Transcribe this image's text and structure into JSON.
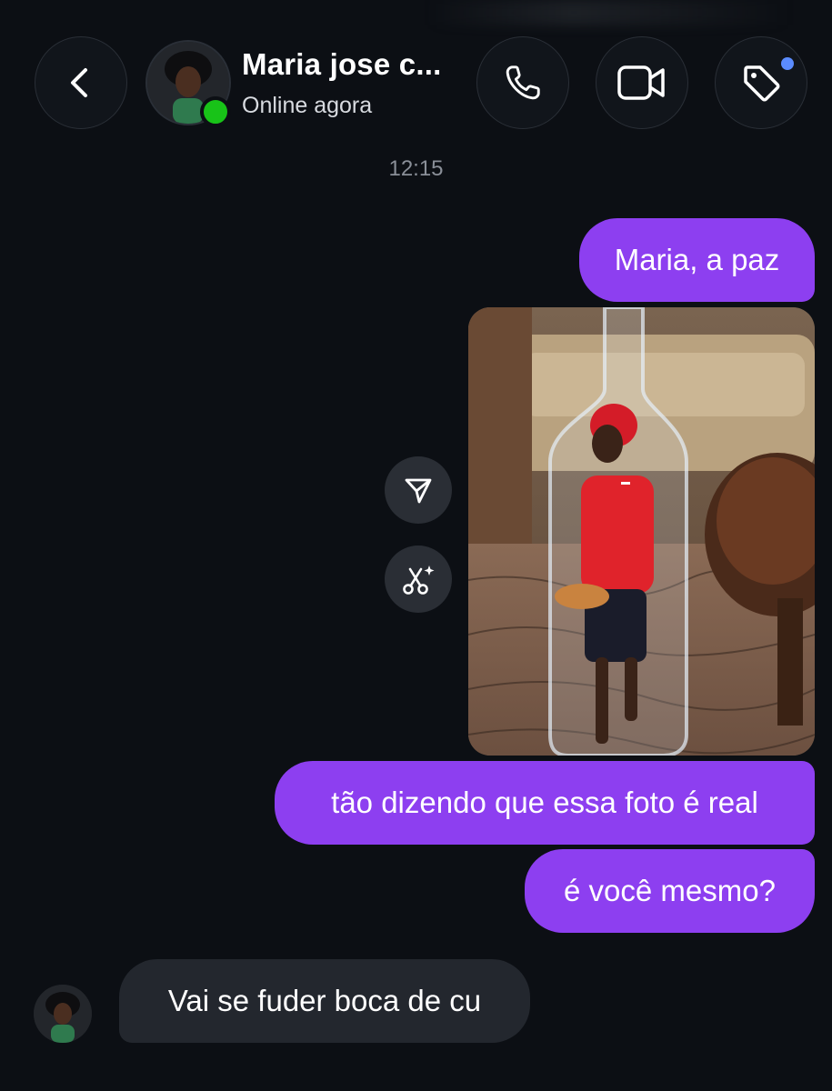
{
  "header": {
    "contact_name": "Maria jose c...",
    "status": "Online agora",
    "icons": {
      "back": "chevron-left-icon",
      "call": "phone-icon",
      "video": "video-camera-icon",
      "tag": "tag-icon"
    }
  },
  "conversation": {
    "timestamp": "12:15",
    "outgoing": [
      {
        "text": "Maria, a paz"
      },
      {
        "type": "photo",
        "description_icon": "photo-bottle-image"
      },
      {
        "text": "tão dizendo que essa foto é real"
      },
      {
        "text": "é você mesmo?"
      }
    ],
    "incoming": [
      {
        "text": "Vai se fuder boca de cu"
      }
    ],
    "photo_actions": {
      "share": "send-icon",
      "remix": "scissors-sparkle-icon"
    }
  },
  "colors": {
    "background": "#0c0f14",
    "outgoing_bubble": "#8d3ff0",
    "incoming_bubble": "#23272e",
    "online": "#18c318",
    "tag_badge": "#5b8cff"
  }
}
